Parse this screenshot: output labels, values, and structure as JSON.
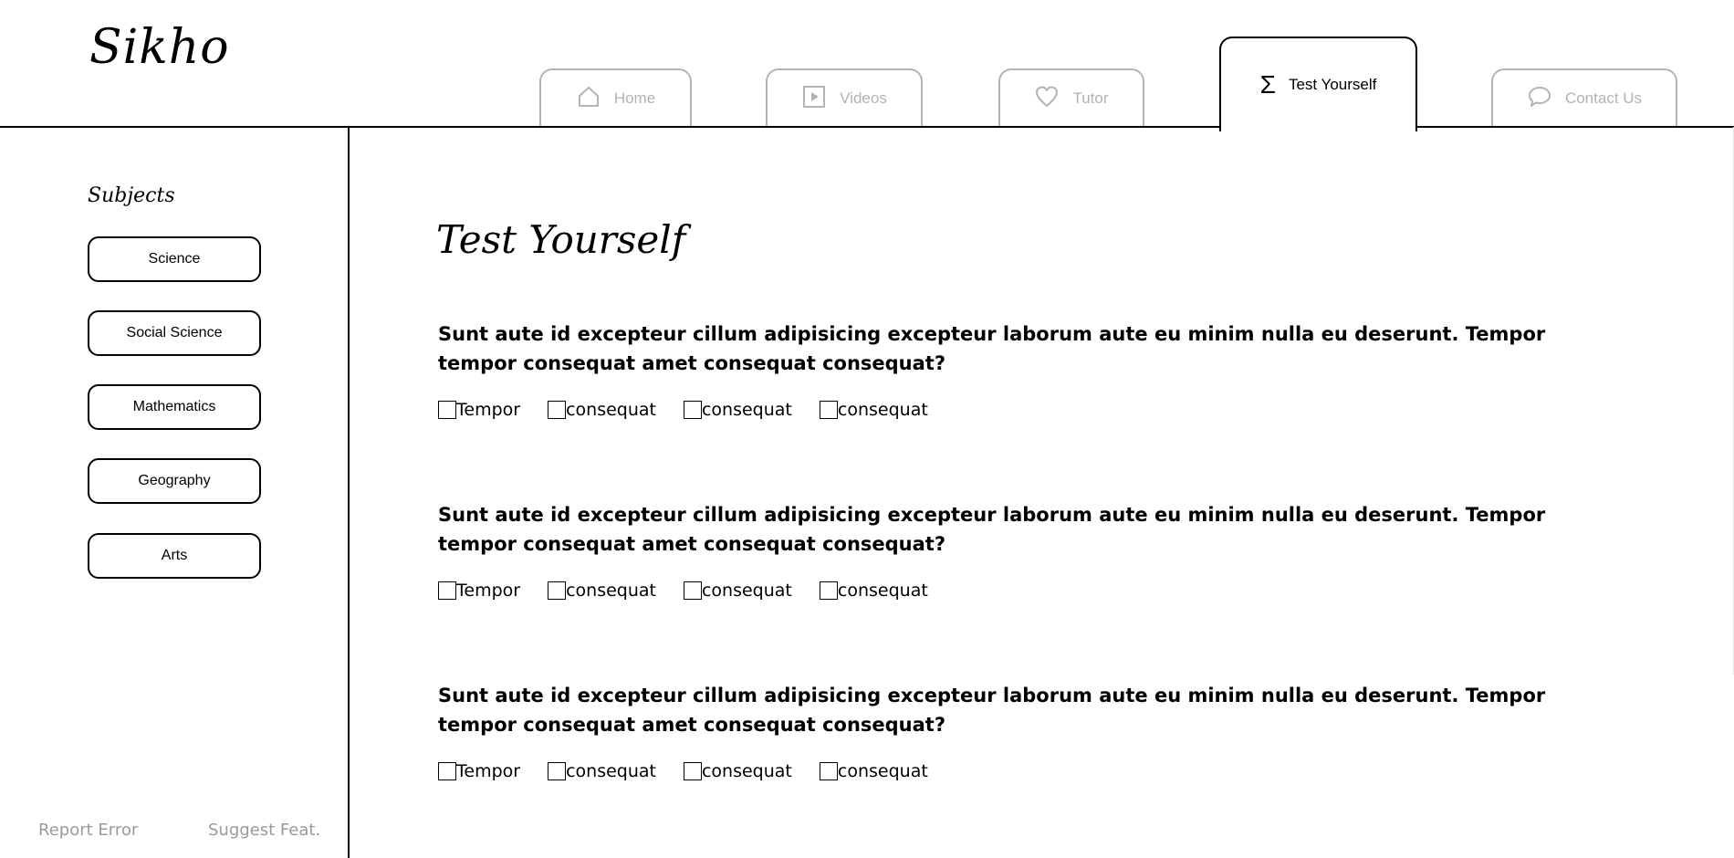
{
  "app": {
    "logo": "Sikho"
  },
  "nav": {
    "tabs": [
      {
        "label": "Home",
        "icon": "home-icon",
        "active": false
      },
      {
        "label": "Videos",
        "icon": "play-icon",
        "active": false
      },
      {
        "label": "Tutor",
        "icon": "heart-icon",
        "active": false
      },
      {
        "label": "Test Yourself",
        "icon": "sigma-icon",
        "active": true
      },
      {
        "label": "Contact Us",
        "icon": "speech-bubble-icon",
        "active": false
      }
    ]
  },
  "sidebar": {
    "title": "Subjects",
    "items": [
      {
        "label": "Science"
      },
      {
        "label": "Social Science"
      },
      {
        "label": "Mathematics"
      },
      {
        "label": "Geography"
      },
      {
        "label": "Arts"
      }
    ],
    "footer": {
      "report": "Report Error",
      "suggest": "Suggest Feat."
    }
  },
  "main": {
    "title": "Test Yourself",
    "questions": [
      {
        "text": "Sunt aute id excepteur cillum adipisicing excepteur laborum aute eu minim nulla eu deserunt. Tempor tempor consequat amet consequat consequat?",
        "options": [
          "Tempor",
          "consequat",
          "consequat",
          "consequat"
        ]
      },
      {
        "text": "Sunt aute id excepteur cillum adipisicing excepteur laborum aute eu minim nulla eu deserunt. Tempor tempor consequat amet consequat consequat?",
        "options": [
          "Tempor",
          "consequat",
          "consequat",
          "consequat"
        ]
      },
      {
        "text": "Sunt aute id excepteur cillum adipisicing excepteur laborum aute eu minim nulla eu deserunt. Tempor tempor consequat amet consequat consequat?",
        "options": [
          "Tempor",
          "consequat",
          "consequat",
          "consequat"
        ]
      }
    ]
  },
  "colors": {
    "text": "#000000",
    "inactive_tab": "#b3b3b3",
    "footer_link": "#9a9a9a",
    "background": "#ffffff"
  }
}
